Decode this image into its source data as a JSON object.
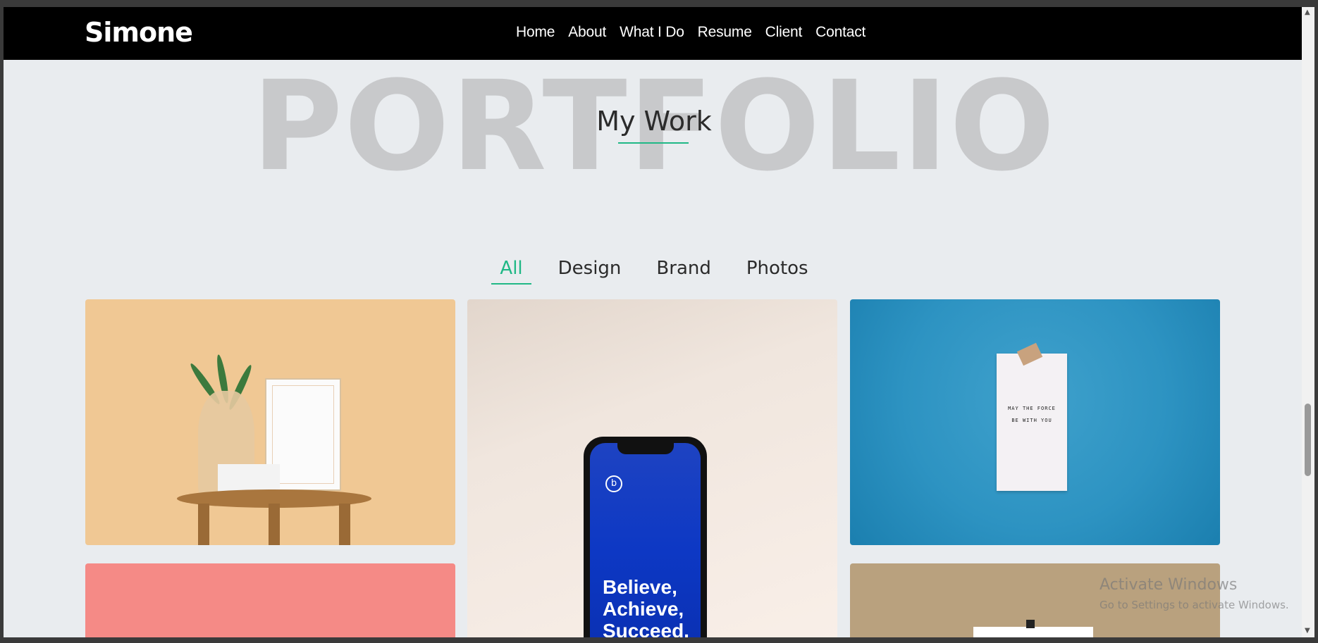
{
  "nav": {
    "brand": "Simone",
    "links": [
      "Home",
      "About",
      "What I Do",
      "Resume",
      "Client",
      "Contact"
    ]
  },
  "portfolio": {
    "background_word": "PORTFOLIO",
    "title": "My Work",
    "filters": [
      {
        "label": "All",
        "active": true
      },
      {
        "label": "Design",
        "active": false
      },
      {
        "label": "Brand",
        "active": false
      },
      {
        "label": "Photos",
        "active": false
      }
    ],
    "tiles": {
      "phone_logo": "b",
      "phone_text_1": "Believe,",
      "phone_text_2": "Achieve,",
      "phone_text_3": "Succeed,",
      "note_line_1": "MAY THE FORCE",
      "note_line_2": "BE WITH YOU"
    }
  },
  "watermark": {
    "title": "Activate Windows",
    "subtitle": "Go to Settings to activate Windows."
  },
  "colors": {
    "accent": "#20b886",
    "nav_bg": "#000000",
    "page_bg": "#e9ecef"
  }
}
